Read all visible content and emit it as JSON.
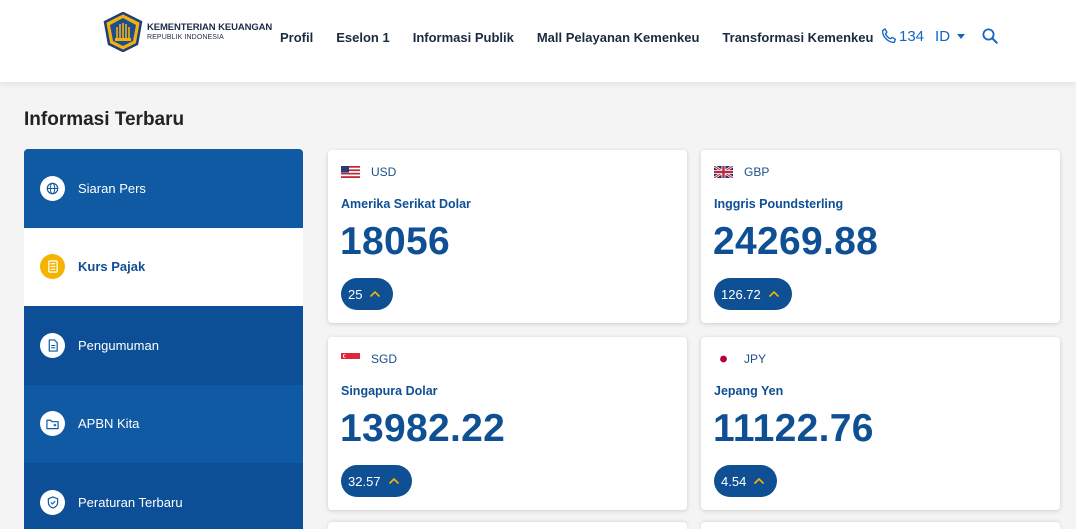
{
  "header": {
    "logo_title": "KEMENTERIAN KEUANGAN",
    "logo_subtitle": "REPUBLIK INDONESIA",
    "nav": [
      "Profil",
      "Eselon 1",
      "Informasi Publik",
      "Mall Pelayanan Kemenkeu",
      "Transformasi Kemenkeu"
    ],
    "phone": "134",
    "lang": "ID"
  },
  "section_title": "Informasi Terbaru",
  "sidebar": [
    {
      "label": "Siaran Pers",
      "icon": "globe-icon"
    },
    {
      "label": "Kurs Pajak",
      "icon": "calculator-icon",
      "active": true
    },
    {
      "label": "Pengumuman",
      "icon": "document-icon"
    },
    {
      "label": "APBN Kita",
      "icon": "folder-icon"
    },
    {
      "label": "Peraturan Terbaru",
      "icon": "shield-icon"
    }
  ],
  "rates": [
    {
      "code": "USD",
      "name": "Amerika Serikat Dolar",
      "value": "18056",
      "change": "25",
      "flag": "us-flag"
    },
    {
      "code": "GBP",
      "name": "Inggris Poundsterling",
      "value": "24269.88",
      "change": "126.72",
      "flag": "gb-flag"
    },
    {
      "code": "SGD",
      "name": "Singapura Dolar",
      "value": "13982.22",
      "change": "32.57",
      "flag": "sg-flag"
    },
    {
      "code": "JPY",
      "name": "Jepang Yen",
      "value": "11122.76",
      "change": "4.54",
      "flag": "jp-flag"
    }
  ],
  "colors": {
    "primary": "#0f4f94",
    "sidebar": "#0f5aa2",
    "accent": "#f5b400",
    "link": "#1565c0"
  }
}
